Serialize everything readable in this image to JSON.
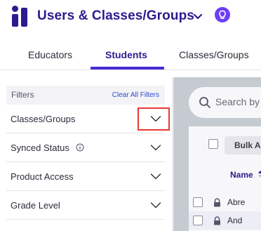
{
  "header": {
    "title": "Users & Classes/Groups",
    "brand_color": "#2b1c8f",
    "accent_color": "#6c3ef5",
    "title_icon": "chevron-down-icon",
    "help_icon": "lightbulb-icon"
  },
  "tabs": [
    {
      "label": "Educators",
      "active": false
    },
    {
      "label": "Students",
      "active": true
    },
    {
      "label": "Classes/Groups",
      "active": false
    }
  ],
  "filters": {
    "title": "Filters",
    "clear_all": "Clear All Filters",
    "items": [
      {
        "label": "Classes/Groups",
        "icon": "chevron-down-icon",
        "highlighted": true
      },
      {
        "label": "Synced Status",
        "icon": "chevron-down-icon",
        "info_icon": "info-icon"
      },
      {
        "label": "Product Access",
        "icon": "chevron-down-icon"
      },
      {
        "label": "Grade Level",
        "icon": "chevron-down-icon"
      }
    ]
  },
  "main": {
    "search_placeholder": "Search by",
    "bulk_button": "Bulk A",
    "name_header": "Name",
    "rows": [
      {
        "name": "Abre",
        "icon": "lock-icon"
      },
      {
        "name": "And",
        "icon": "lock-icon"
      }
    ]
  }
}
